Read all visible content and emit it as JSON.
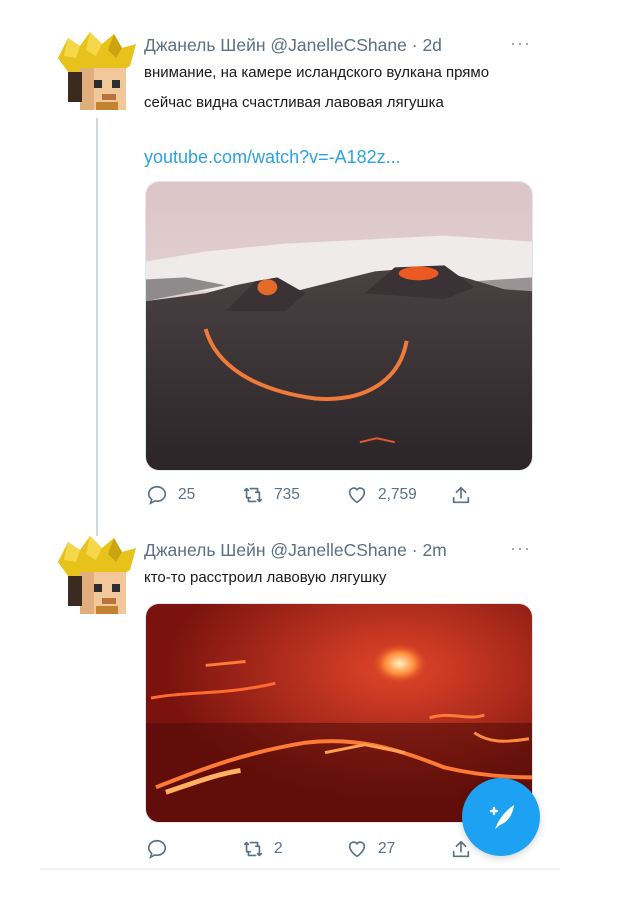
{
  "tweets": [
    {
      "author_name": "Джанель Шейн",
      "handle": "@JanelleCShane",
      "time": "2d",
      "text_lines": [
        "внимание, на камере исландского вулкана прямо",
        "сейчас видна счастливая лавовая лягушка"
      ],
      "link": "youtube.com/watch?v=-A182z...",
      "media_icon": "volcano-smiley-photo",
      "actions": {
        "replies": "25",
        "retweets": "735",
        "likes": "2,759"
      }
    },
    {
      "author_name": "Джанель Шейн",
      "handle": "@JanelleCShane",
      "time": "2m",
      "text_lines": [
        "кто-то расстроил лавовую лягушку"
      ],
      "media_icon": "lava-field-photo",
      "actions": {
        "replies": "",
        "retweets": "2",
        "likes": "27"
      }
    }
  ],
  "separator": "·",
  "more_glyph": "···",
  "colors": {
    "accent": "#1da1f2",
    "link": "#2aa3e0",
    "muted": "#5b7083"
  }
}
